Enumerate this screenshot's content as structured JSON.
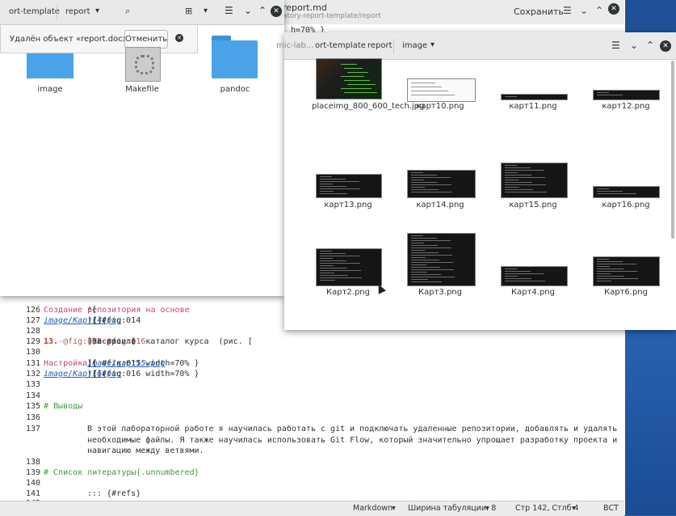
{
  "editor": {
    "title": "report.md",
    "path": "...nic-laboratory-report-template/report",
    "save_label": "Сохранить",
    "top_fragment": "h=70% }",
    "lines": [
      {
        "n": "126",
        "parts": [
          {
            "c": "tx",
            "t": "!["
          },
          {
            "c": "lnk",
            "t": "Создание репозитория на основе"
          }
        ]
      },
      {
        "n": "127",
        "parts": [
          {
            "c": "tx",
            "t": "![]("
          },
          {
            "c": "it",
            "t": "image/Карт14.png"
          },
          {
            "c": "tx",
            "t": "){ #fig:014"
          }
        ]
      },
      {
        "n": "128",
        "parts": []
      },
      {
        "n": "129",
        "parts": [
          {
            "c": "num",
            "t": "13."
          },
          {
            "c": "tx",
            "t": " Настроила  каталог курса  (рис. ["
          },
          {
            "c": "ref",
            "t": "-@fig:015"
          },
          {
            "c": "tx",
            "t": "] и рис. ["
          },
          {
            "c": "ref",
            "t": "-@fig:016"
          },
          {
            "c": "tx",
            "t": "])"
          }
        ]
      },
      {
        "n": "130",
        "parts": []
      },
      {
        "n": "131",
        "parts": [
          {
            "c": "tx",
            "t": "!["
          },
          {
            "c": "lnk",
            "t": "Настройка"
          },
          {
            "c": "tx",
            "t": "]("
          },
          {
            "c": "it",
            "t": "image/карт15.png"
          },
          {
            "c": "tx",
            "t": "){ #fig:015 width=70% }"
          }
        ]
      },
      {
        "n": "132",
        "parts": [
          {
            "c": "tx",
            "t": "![]("
          },
          {
            "c": "it",
            "t": "image/Карт16.png"
          },
          {
            "c": "tx",
            "t": "){ #fig:016 width=70% }"
          }
        ]
      },
      {
        "n": "133",
        "parts": []
      },
      {
        "n": "134",
        "parts": []
      },
      {
        "n": "135",
        "parts": [
          {
            "c": "hd",
            "t": "# Выводы"
          }
        ]
      },
      {
        "n": "136",
        "parts": []
      },
      {
        "n": "137",
        "parts": [
          {
            "c": "tx",
            "t": "В этой лабораторной работе я научилась работать с git и подключать удаленные репозитории, добавлять и удалять"
          }
        ]
      },
      {
        "n": "",
        "parts": [
          {
            "c": "tx",
            "t": "необходимые файлы. Я также научилась использовать Git Flow, который значительно упрощает разработку проекта и"
          }
        ]
      },
      {
        "n": "",
        "parts": [
          {
            "c": "tx",
            "t": "навигацию между ветвями."
          }
        ]
      },
      {
        "n": "138",
        "parts": []
      },
      {
        "n": "139",
        "parts": [
          {
            "c": "hd",
            "t": "# Список литературы{.unnumbered}"
          }
        ]
      },
      {
        "n": "140",
        "parts": []
      },
      {
        "n": "141",
        "parts": [
          {
            "c": "tx",
            "t": "::: {#refs}"
          }
        ]
      },
      {
        "n": "142",
        "parts": [
          {
            "c": "tx",
            "t": ":::"
          }
        ]
      }
    ],
    "status": {
      "syntax": "Markdown",
      "tab_width": "Ширина табуляции: 8",
      "cursor": "Стр 142, Стлб 4",
      "mode": "ВСТ"
    }
  },
  "fm1": {
    "crumbs": [
      "ort-template",
      "report"
    ],
    "toast_text": "Удалён объект «report.docx»",
    "undo_label": "Отменить",
    "items": [
      {
        "label": "image",
        "kind": "folder"
      },
      {
        "label": "Makefile",
        "kind": "makefile"
      },
      {
        "label": "pandoc",
        "kind": "folder"
      }
    ]
  },
  "fm2": {
    "crumbs": [
      "mic-lab...",
      "ort-template",
      "report",
      "image"
    ],
    "items": [
      {
        "label": "placeimg_800_600_tech.jpg"
      },
      {
        "label": "карт10.png"
      },
      {
        "label": "карт11.png"
      },
      {
        "label": "карт12.png"
      },
      {
        "label": "карт13.png"
      },
      {
        "label": "карт14.png"
      },
      {
        "label": "карт15.png"
      },
      {
        "label": "карт16.png"
      },
      {
        "label": "Карт2.png"
      },
      {
        "label": "Карт3.png"
      },
      {
        "label": "Карт4.png"
      },
      {
        "label": "Карт6.png"
      }
    ]
  },
  "colors": {
    "desktop": "#2a5fa8",
    "folder": "#4aa3e8",
    "link": "#c2477a",
    "heading": "#3e9a3e"
  }
}
